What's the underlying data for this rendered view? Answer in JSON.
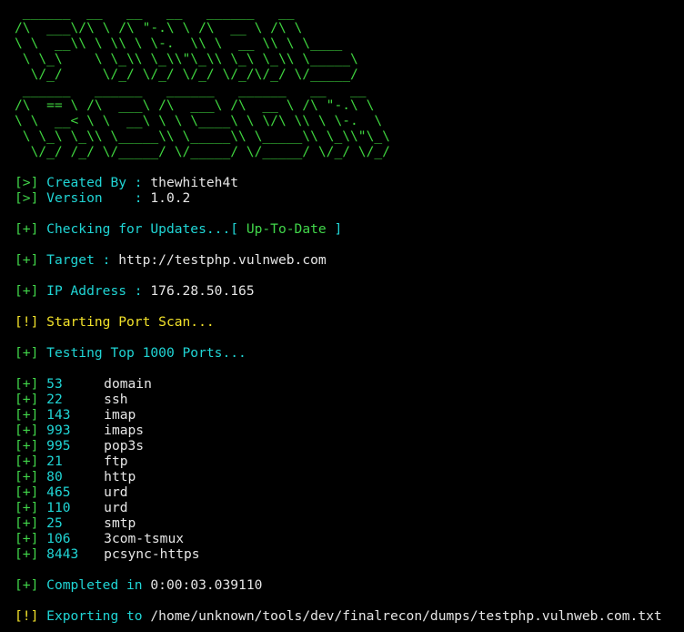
{
  "banner": {
    "line1": " ______  __   __   __   ______   __",
    "line2": "/\\  ___\\/\\ \\ /\\ \"-.\\ \\ /\\  __ \\ /\\ \\",
    "line3": "\\ \\  __\\\\ \\ \\\\ \\ \\-.  \\\\ \\  __ \\\\ \\ \\____",
    "line4": " \\ \\_\\    \\ \\_\\\\ \\_\\\\\"\\_\\\\ \\_\\ \\_\\\\ \\_____\\",
    "line5": "  \\/_/     \\/_/ \\/_/ \\/_/ \\/_/\\/_/ \\/_____/",
    "line6": " ______   ______   ______   ______   __   __",
    "line7": "/\\  == \\ /\\  ___\\ /\\  ___\\ /\\  __ \\ /\\ \"-.\\ \\",
    "line8": "\\ \\  __< \\ \\  __\\ \\ \\ \\____\\ \\ \\/\\ \\\\ \\ \\-.  \\",
    "line9": " \\ \\_\\ \\_\\\\ \\_____\\\\ \\_____\\\\ \\_____\\\\ \\_\\\\\"\\_\\",
    "line10": "  \\/_/ /_/ \\/_____/ \\/_____/ \\/_____/ \\/_/ \\/_/"
  },
  "info": {
    "created_prefix": "[>]",
    "created_label": "Created By :",
    "created_value": "thewhiteh4t",
    "version_prefix": "[>]",
    "version_label": "Version    :",
    "version_value": "1.0.2"
  },
  "updates": {
    "prefix": "[+]",
    "label": "Checking for Updates...[",
    "status": "Up-To-Date",
    "close": "]"
  },
  "target": {
    "prefix": "[+]",
    "label": "Target :",
    "value": "http://testphp.vulnweb.com"
  },
  "ip": {
    "prefix": "[+]",
    "label": "IP Address :",
    "value": "176.28.50.165"
  },
  "scan_start": {
    "prefix": "[!]",
    "label": "Starting Port Scan..."
  },
  "testing": {
    "prefix": "[+]",
    "label": "Testing Top 1000 Ports..."
  },
  "ports": [
    {
      "prefix": "[+]",
      "port": "53",
      "service": "domain"
    },
    {
      "prefix": "[+]",
      "port": "22",
      "service": "ssh"
    },
    {
      "prefix": "[+]",
      "port": "143",
      "service": "imap"
    },
    {
      "prefix": "[+]",
      "port": "993",
      "service": "imaps"
    },
    {
      "prefix": "[+]",
      "port": "995",
      "service": "pop3s"
    },
    {
      "prefix": "[+]",
      "port": "21",
      "service": "ftp"
    },
    {
      "prefix": "[+]",
      "port": "80",
      "service": "http"
    },
    {
      "prefix": "[+]",
      "port": "465",
      "service": "urd"
    },
    {
      "prefix": "[+]",
      "port": "110",
      "service": "urd"
    },
    {
      "prefix": "[+]",
      "port": "25",
      "service": "smtp"
    },
    {
      "prefix": "[+]",
      "port": "106",
      "service": "3com-tsmux"
    },
    {
      "prefix": "[+]",
      "port": "8443",
      "service": "pcsync-https"
    }
  ],
  "completed": {
    "prefix": "[+]",
    "label": "Completed in",
    "value": "0:00:03.039110"
  },
  "export": {
    "prefix": "[!]",
    "label": "Exporting to",
    "value": "/home/unknown/tools/dev/finalrecon/dumps/testphp.vulnweb.com.txt"
  },
  "colors": {
    "background": "#000000",
    "green": "#41d64a",
    "cyan": "#20d5d5",
    "white": "#e6e6e6",
    "yellow": "#f2e22a"
  }
}
